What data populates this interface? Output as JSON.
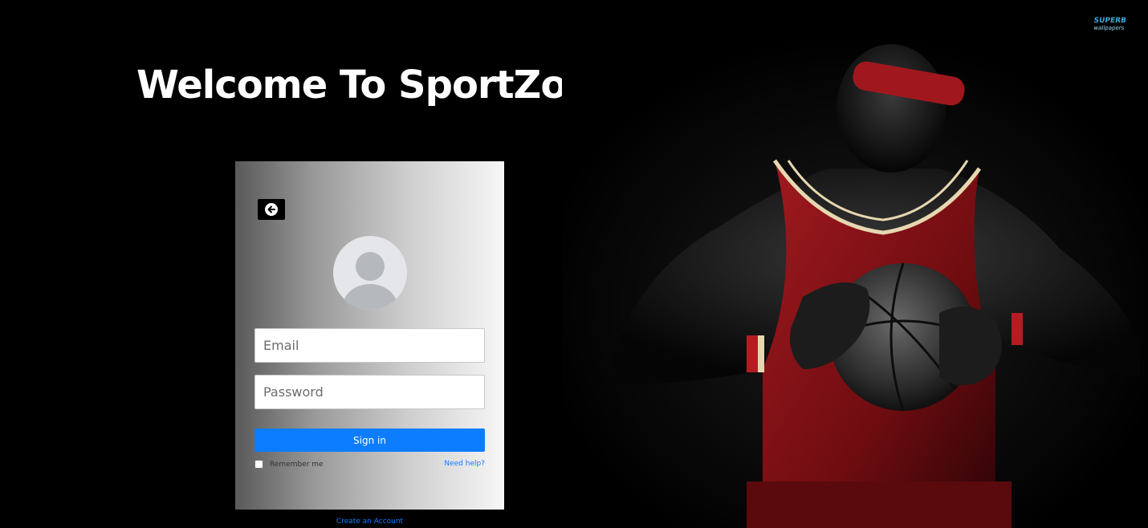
{
  "page": {
    "welcome_title": "Welcome To SportZoneHub",
    "watermark_line1": "SUPERB",
    "watermark_line2": "wallpapers"
  },
  "login": {
    "back_icon": "arrow-left-circle-icon",
    "avatar_icon": "user-avatar-icon",
    "email_placeholder": "Email",
    "password_placeholder": "Password",
    "signin_label": "Sign in",
    "remember_label": "Remember me",
    "remember_checked": false,
    "need_help_label": "Need help?",
    "create_account_label": "Create an Account"
  },
  "colors": {
    "background": "#000000",
    "accent": "#0d7dff",
    "title": "#ffffff",
    "jersey": "#8e1015"
  }
}
